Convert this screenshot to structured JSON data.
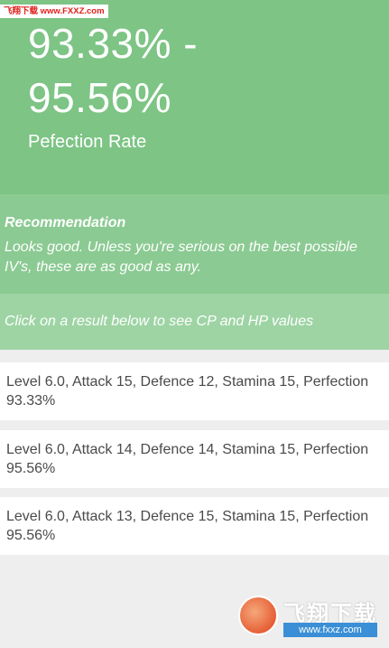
{
  "watermark": {
    "top_text": "飞翔下载 www.FXXZ.com",
    "logo_text": "飞翔下载",
    "logo_url": "www.fxxz.com"
  },
  "perfection": {
    "rate_line1": "93.33% -",
    "rate_line2": "95.56%",
    "label": "Pefection Rate"
  },
  "recommendation": {
    "title": "Recommendation",
    "text": "Looks good. Unless you're serious on the best possible IV's, these are as good as any."
  },
  "hint": "Click on a result below to see CP and HP values",
  "results": [
    {
      "text": "Level 6.0, Attack 15, Defence 12, Stamina 15, Perfection 93.33%"
    },
    {
      "text": "Level 6.0, Attack 14, Defence 14, Stamina 15, Perfection 95.56%"
    },
    {
      "text": "Level 6.0, Attack 13, Defence 15, Stamina 15, Perfection 95.56%"
    }
  ],
  "colors": {
    "hero": "#7dc485",
    "recommendation": "#8bca92",
    "hint": "#9ed4a4",
    "background": "#eeeeee"
  }
}
